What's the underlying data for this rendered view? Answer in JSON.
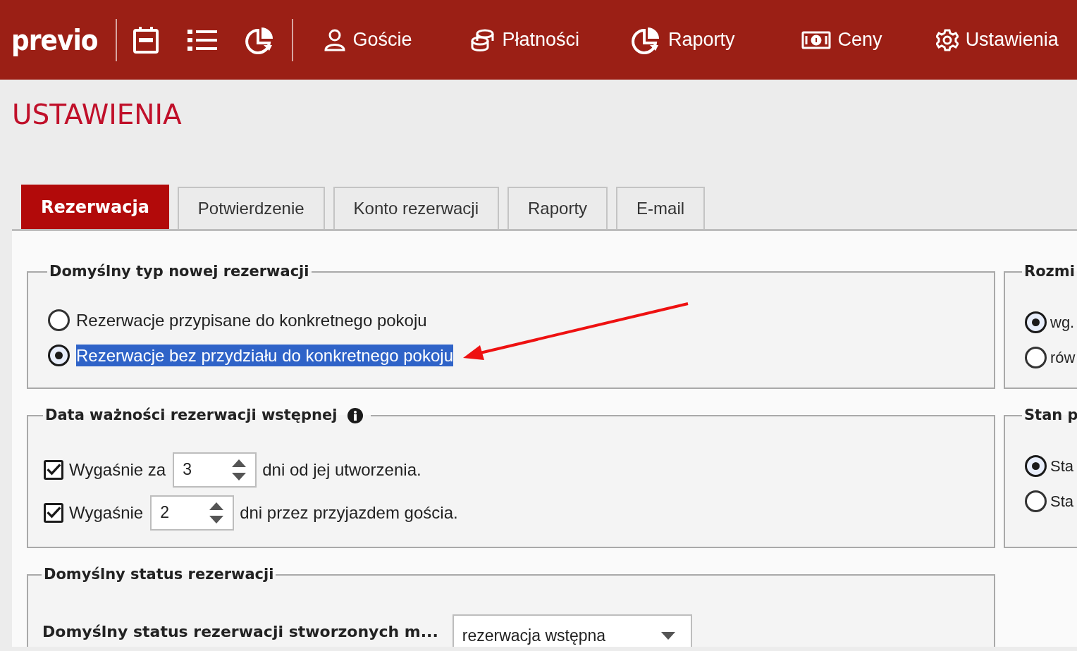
{
  "nav": {
    "logo": "previo",
    "icon_buttons": [
      {
        "kind": "calendar"
      },
      {
        "kind": "list"
      },
      {
        "kind": "chart"
      }
    ],
    "items": [
      {
        "label": "Goście",
        "kind": "user"
      },
      {
        "label": "Płatności",
        "kind": "coins"
      },
      {
        "label": "Raporty",
        "kind": "chart"
      },
      {
        "label": "Ceny",
        "kind": "money"
      },
      {
        "label": "Ustawienia",
        "kind": "gear"
      }
    ]
  },
  "page_title": "USTAWIENIA",
  "tabs": [
    {
      "label": "Rezerwacja",
      "selected": true
    },
    {
      "label": "Potwierdzenie",
      "selected": false
    },
    {
      "label": "Konto rezerwacji",
      "selected": false
    },
    {
      "label": "Raporty",
      "selected": false
    },
    {
      "label": "E-mail",
      "selected": false
    }
  ],
  "left_sections": [
    {
      "kind": "radio",
      "legend": "Domyślny typ nowej rezerwacji",
      "options": [
        {
          "label": "Rezerwacje przypisane do konkretnego pokoju",
          "selected": false,
          "highlighted": false
        },
        {
          "label": "Rezerwacje bez przydziału do konkretnego pokoju",
          "selected": true,
          "highlighted": true
        }
      ]
    },
    {
      "kind": "expiry",
      "legend": "Data ważności rezerwacji wstępnej",
      "info": true,
      "rows": [
        {
          "checked": true,
          "label_before": "Wygaśnie za",
          "value": "3",
          "label_after": "dni od jej utworzenia."
        },
        {
          "checked": true,
          "label_before": "Wygaśnie",
          "value": "2",
          "label_after": "dni przez przyjazdem gościa."
        }
      ]
    },
    {
      "kind": "select",
      "legend": "Domyślny status rezerwacji",
      "label": "Domyślny status rezerwacji stworzonych m...",
      "value": "rezerwacja wstępna"
    }
  ],
  "right_sections": [
    {
      "legend": "Rozmi",
      "options": [
        {
          "label": "wg.",
          "selected": true
        },
        {
          "label": "rów",
          "selected": false
        }
      ]
    },
    {
      "legend": "Stan p",
      "options": [
        {
          "label": "Sta",
          "selected": true
        },
        {
          "label": "Sta",
          "selected": false
        }
      ]
    }
  ]
}
